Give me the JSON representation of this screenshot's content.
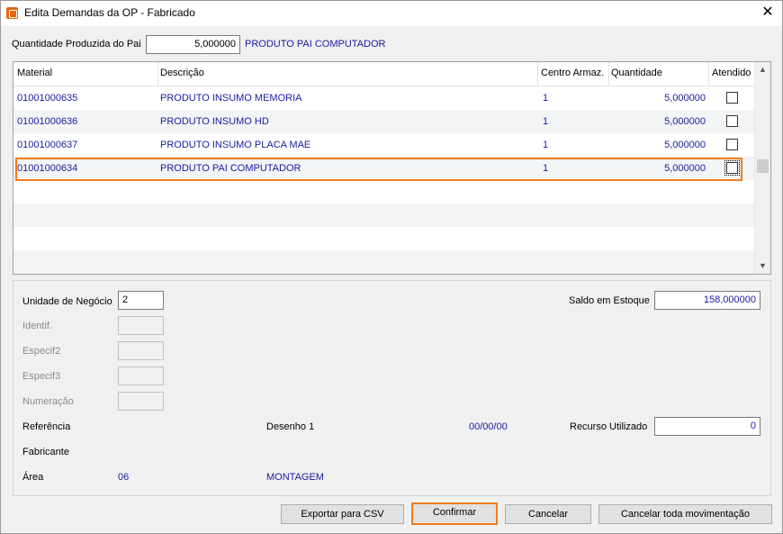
{
  "window": {
    "title": "Edita Demandas da OP - Fabricado",
    "app_icon": "app-logo-icon",
    "close_icon": "close-icon"
  },
  "header": {
    "qty_label": "Quantidade Produzida do Pai",
    "qty_value": "5,000000",
    "parent_name": "PRODUTO PAI COMPUTADOR"
  },
  "grid": {
    "columns": [
      "Material",
      "Descrição",
      "Centro Armaz.",
      "Quantidade",
      "Atendido"
    ],
    "rows": [
      {
        "material": "01001000635",
        "descricao": "PRODUTO INSUMO MEMORIA",
        "centro": "1",
        "quantidade": "5,000000",
        "atendido": false
      },
      {
        "material": "01001000636",
        "descricao": "PRODUTO INSUMO HD",
        "centro": "1",
        "quantidade": "5,000000",
        "atendido": false
      },
      {
        "material": "01001000637",
        "descricao": "PRODUTO INSUMO PLACA MAE",
        "centro": "1",
        "quantidade": "5,000000",
        "atendido": false
      },
      {
        "material": "01001000634",
        "descricao": "PRODUTO PAI COMPUTADOR",
        "centro": "1",
        "quantidade": "5,000000",
        "atendido": false
      }
    ],
    "highlight_color": "#f07c1e"
  },
  "details": {
    "unidade_label": "Unidade de Negócio",
    "unidade_value": "2",
    "identif_label": "Identif.",
    "especif2_label": "Especif2",
    "especif3_label": "Especif3",
    "numeracao_label": "Numeração",
    "referencia_label": "Referência",
    "desenho_label": "Desenho 1",
    "date_value": "00/00/00",
    "fabricante_label": "Fabricante",
    "area_label": "Área",
    "area_code": "06",
    "area_name": "MONTAGEM",
    "saldo_label": "Saldo em Estoque",
    "saldo_value": "158,000000",
    "recurso_label": "Recurso Utilizado",
    "recurso_value": "0"
  },
  "buttons": {
    "export": "Exportar para CSV",
    "confirm": "Confirmar",
    "cancel": "Cancelar",
    "cancel_all": "Cancelar toda movimentação"
  }
}
